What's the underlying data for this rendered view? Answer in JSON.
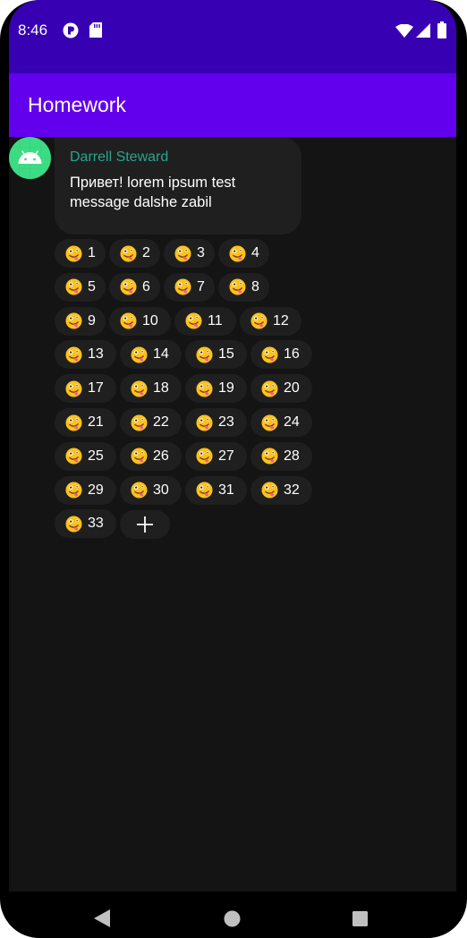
{
  "status_bar": {
    "time": "8:46"
  },
  "app_bar": {
    "title": "Homework"
  },
  "message": {
    "author": "Darrell Steward",
    "text": "Привет! lorem ipsum test message dalshe zabil"
  },
  "reactions": [
    {
      "emoji": "zany-face",
      "count": "1"
    },
    {
      "emoji": "zany-face",
      "count": "2"
    },
    {
      "emoji": "zany-face",
      "count": "3"
    },
    {
      "emoji": "zany-face",
      "count": "4"
    },
    {
      "emoji": "zany-face",
      "count": "5"
    },
    {
      "emoji": "zany-face",
      "count": "6"
    },
    {
      "emoji": "zany-face",
      "count": "7"
    },
    {
      "emoji": "zany-face",
      "count": "8"
    },
    {
      "emoji": "zany-face",
      "count": "9"
    },
    {
      "emoji": "zany-face",
      "count": "10"
    },
    {
      "emoji": "zany-face",
      "count": "11"
    },
    {
      "emoji": "zany-face",
      "count": "12"
    },
    {
      "emoji": "zany-face",
      "count": "13"
    },
    {
      "emoji": "zany-face",
      "count": "14"
    },
    {
      "emoji": "zany-face",
      "count": "15"
    },
    {
      "emoji": "zany-face",
      "count": "16"
    },
    {
      "emoji": "zany-face",
      "count": "17"
    },
    {
      "emoji": "zany-face",
      "count": "18"
    },
    {
      "emoji": "zany-face",
      "count": "19"
    },
    {
      "emoji": "zany-face",
      "count": "20"
    },
    {
      "emoji": "zany-face",
      "count": "21"
    },
    {
      "emoji": "zany-face",
      "count": "22"
    },
    {
      "emoji": "zany-face",
      "count": "23"
    },
    {
      "emoji": "zany-face",
      "count": "24"
    },
    {
      "emoji": "zany-face",
      "count": "25"
    },
    {
      "emoji": "zany-face",
      "count": "26"
    },
    {
      "emoji": "zany-face",
      "count": "27"
    },
    {
      "emoji": "zany-face",
      "count": "28"
    },
    {
      "emoji": "zany-face",
      "count": "29"
    },
    {
      "emoji": "zany-face",
      "count": "30"
    },
    {
      "emoji": "zany-face",
      "count": "31"
    },
    {
      "emoji": "zany-face",
      "count": "32"
    },
    {
      "emoji": "zany-face",
      "count": "33"
    }
  ],
  "colors": {
    "status_bar": "#3700b3",
    "app_bar": "#6200ee",
    "background": "#141414",
    "bubble": "#1f1f1f",
    "author": "#28a68c",
    "avatar": "#3ddc84"
  },
  "icons": {
    "status": [
      "play-store-icon",
      "sd-card-icon",
      "wifi-icon",
      "signal-icon",
      "battery-icon"
    ],
    "nav": [
      "back-icon",
      "home-icon",
      "recents-icon"
    ],
    "add_reaction": "plus-icon"
  }
}
